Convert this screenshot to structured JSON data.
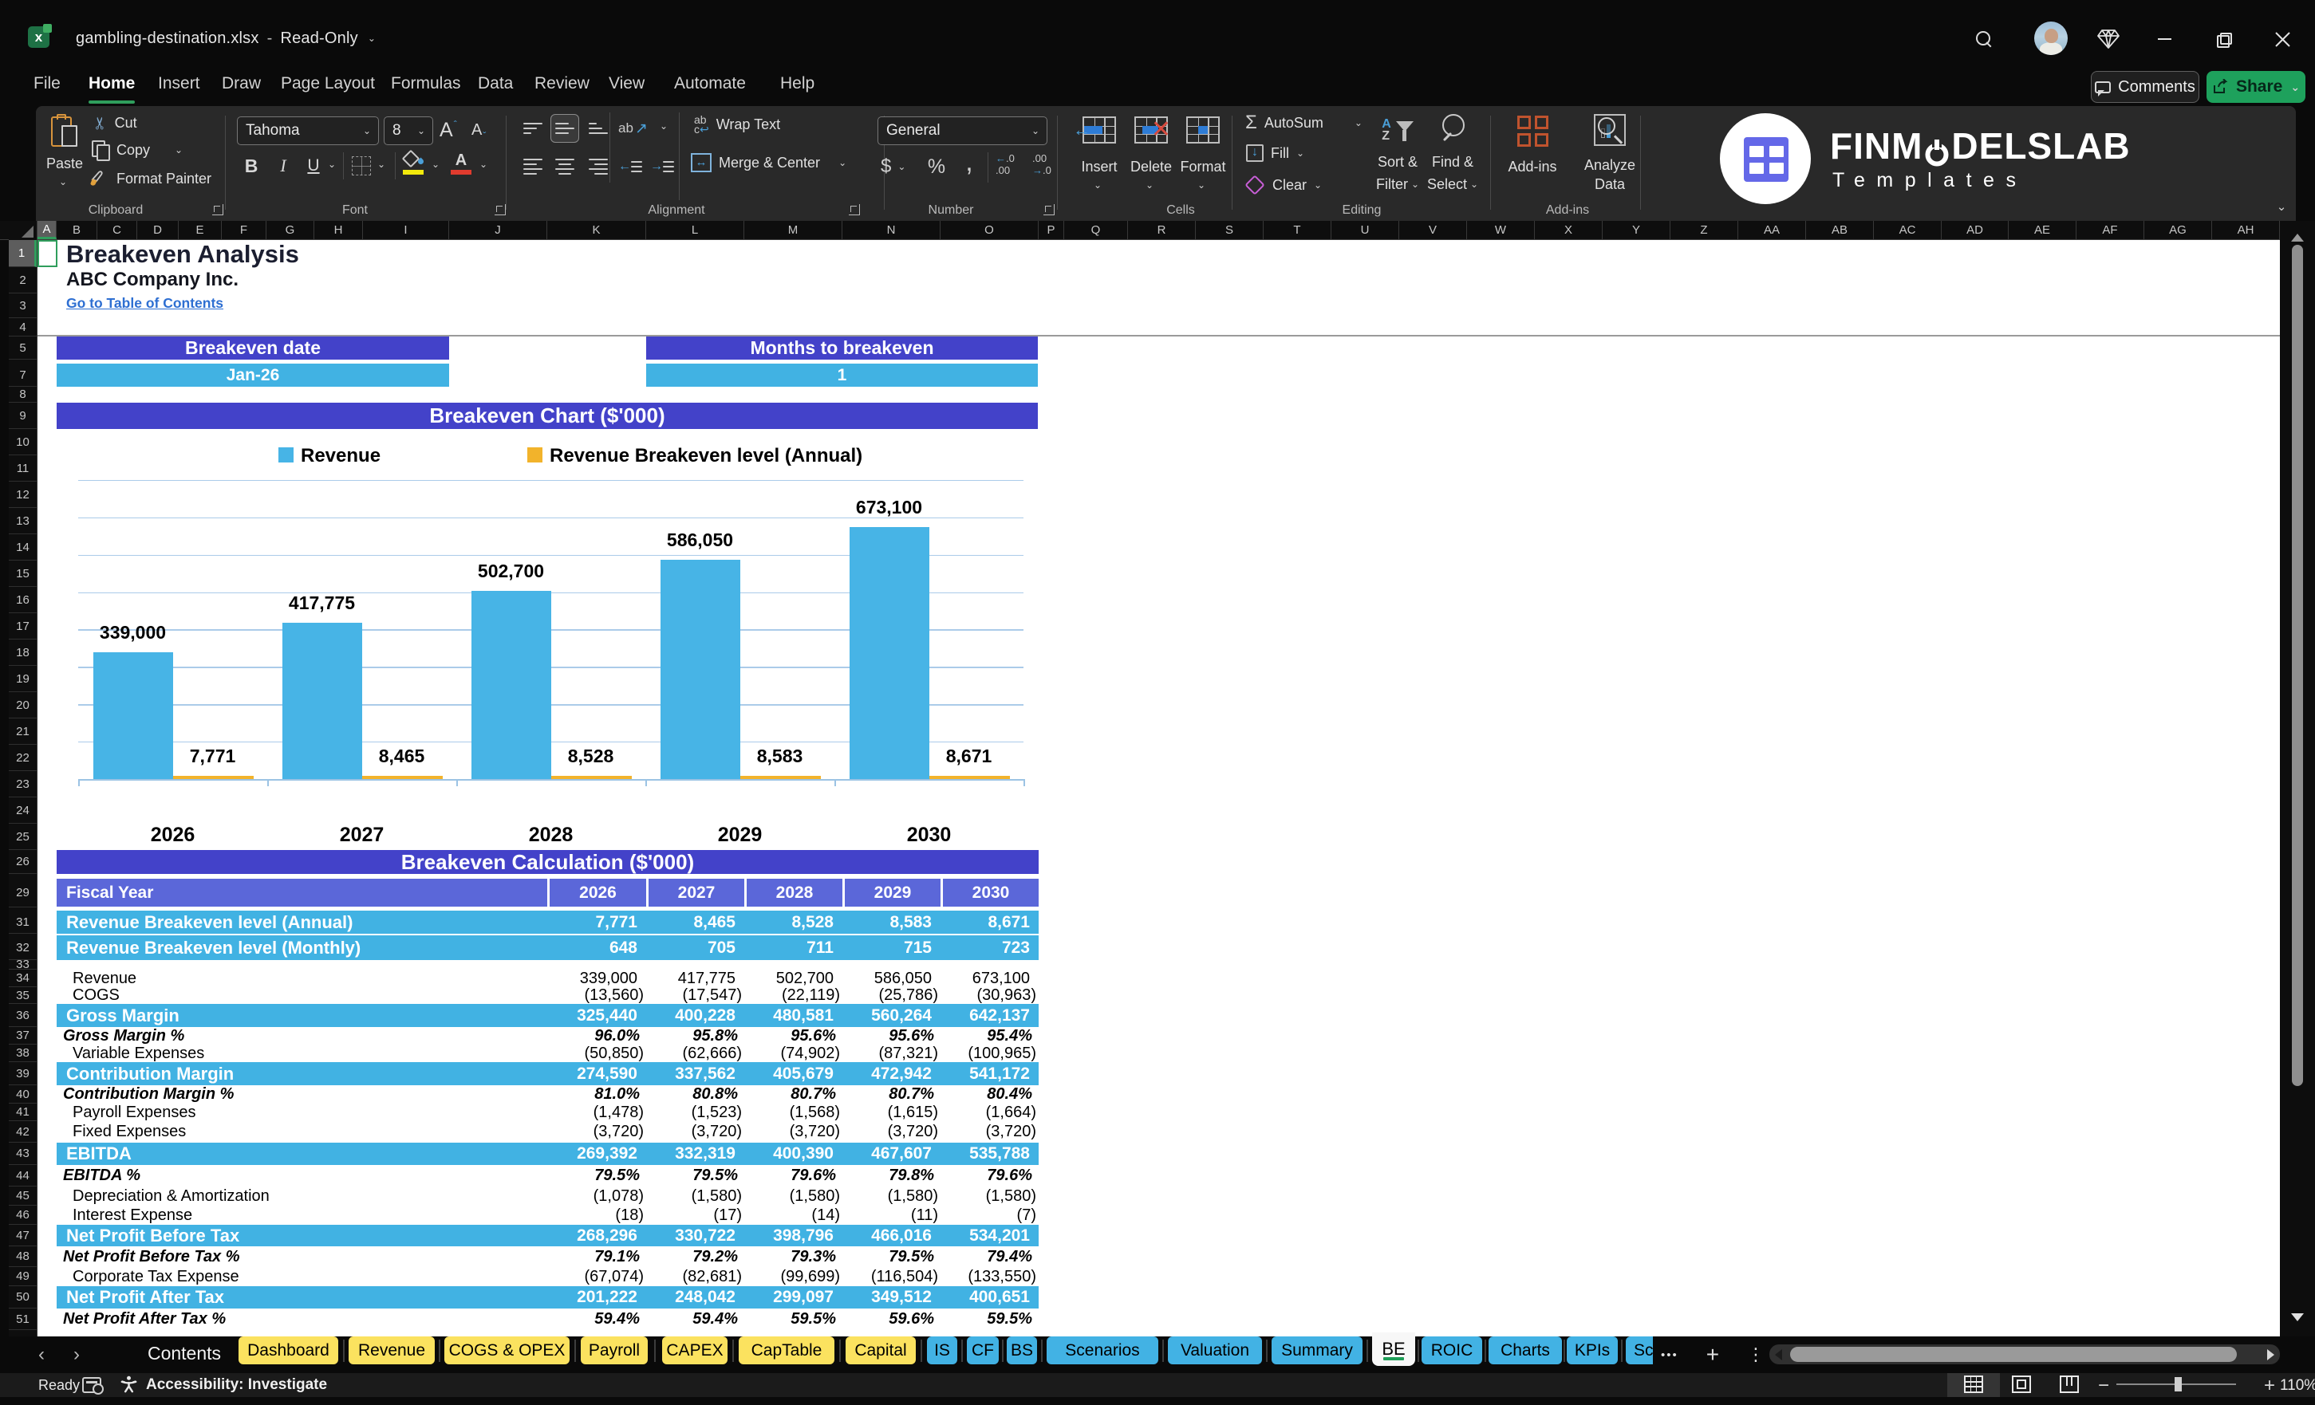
{
  "window": {
    "title": "gambling-destination.xlsx",
    "separator": "-",
    "mode": "Read-Only"
  },
  "menu": {
    "items": [
      "File",
      "Home",
      "Insert",
      "Draw",
      "Page Layout",
      "Formulas",
      "Data",
      "Review",
      "View",
      "Automate",
      "Help"
    ],
    "active_item": "Home",
    "comments": "Comments",
    "share": "Share"
  },
  "ribbon": {
    "clipboard": {
      "label": "Clipboard",
      "paste": "Paste",
      "cut": "Cut",
      "copy": "Copy",
      "format_painter": "Format Painter"
    },
    "font": {
      "label": "Font",
      "family": "Tahoma",
      "size": "8",
      "bold": "B",
      "italic": "I",
      "underline": "U",
      "color_letter": "A"
    },
    "alignment": {
      "label": "Alignment",
      "wrap": "Wrap Text",
      "merge": "Merge & Center",
      "orient": "ab"
    },
    "number": {
      "label": "Number",
      "format": "General",
      "currency": "$",
      "percent": "%",
      "comma": ",",
      "inc_dec": "←.0 .00",
      "dec_dec": ".00 →.0"
    },
    "cells": {
      "label": "Cells",
      "insert": "Insert",
      "delete": "Delete",
      "format": "Format"
    },
    "editing": {
      "label": "Editing",
      "autosum": "AutoSum",
      "fill": "Fill",
      "clear": "Clear",
      "sort1": "Sort &",
      "sort2": "Filter",
      "find1": "Find &",
      "find2": "Select"
    },
    "addins": {
      "label": "Add-ins",
      "button": "Add-ins",
      "analyze1": "Analyze",
      "analyze2": "Data"
    }
  },
  "logo": {
    "brand_pre": "FINM",
    "brand_post": "DELSLAB",
    "sub": "Templates"
  },
  "sheet": {
    "columns": [
      "A",
      "B",
      "C",
      "D",
      "E",
      "F",
      "G",
      "H",
      "I",
      "J",
      "K",
      "L",
      "M",
      "N",
      "O",
      "P",
      "Q",
      "R",
      "S",
      "T",
      "U",
      "V",
      "W",
      "X",
      "Y",
      "Z",
      "AA",
      "AB",
      "AC",
      "AD",
      "AE",
      "AF",
      "AG",
      "AH"
    ],
    "selected_column": "A",
    "rows": [
      "1",
      "2",
      "3",
      "4",
      "5",
      "7",
      "8",
      "9",
      "10",
      "11",
      "12",
      "13",
      "14",
      "15",
      "16",
      "17",
      "18",
      "19",
      "20",
      "21",
      "22",
      "23",
      "24",
      "25",
      "26",
      "29",
      "31",
      "32",
      "33",
      "34",
      "35",
      "36",
      "37",
      "38",
      "39",
      "40",
      "41",
      "42",
      "43",
      "44",
      "45",
      "46",
      "47",
      "48",
      "49",
      "50",
      "51"
    ],
    "selected_row": "1",
    "title": "Breakeven Analysis",
    "company": "ABC Company Inc.",
    "link": "Go to Table of Contents",
    "cards": [
      {
        "label": "Breakeven date",
        "value": "Jan-26"
      },
      {
        "label": "Months to breakeven",
        "value": "1"
      }
    ],
    "chart_header": "Breakeven Chart ($'000)",
    "calc_header": "Breakeven Calculation ($'000)"
  },
  "chart_data": {
    "type": "bar",
    "title": "Breakeven Chart ($'000)",
    "categories": [
      "2026",
      "2027",
      "2028",
      "2029",
      "2030"
    ],
    "series": [
      {
        "name": "Revenue",
        "color": "#47b4e6",
        "values": [
          339000,
          417775,
          502700,
          586050,
          673100
        ],
        "labels": [
          "339,000",
          "417,775",
          "502,700",
          "586,050",
          "673,100"
        ]
      },
      {
        "name": "Revenue Breakeven level (Annual)",
        "color": "#f2b32b",
        "values": [
          7771,
          8465,
          8528,
          8583,
          8671
        ],
        "labels": [
          "7,771",
          "8,465",
          "8,528",
          "8,583",
          "8,671"
        ]
      }
    ],
    "xlabel": "",
    "ylabel": "",
    "ylim": [
      0,
      800000
    ],
    "grid_step": 100000,
    "gridlines": true,
    "legend_position": "top"
  },
  "table": {
    "header": "Fiscal Year",
    "years": [
      "2026",
      "2027",
      "2028",
      "2029",
      "2030"
    ],
    "rows": [
      {
        "label": "Revenue Breakeven level (Annual)",
        "style": "band",
        "values": [
          "7,771",
          "8,465",
          "8,528",
          "8,583",
          "8,671"
        ]
      },
      {
        "label": "Revenue Breakeven level (Monthly)",
        "style": "band",
        "values": [
          "648",
          "705",
          "711",
          "715",
          "723"
        ]
      },
      {
        "label": "",
        "style": "spacer",
        "values": [
          "",
          "",
          "",
          "",
          ""
        ]
      },
      {
        "label": "Revenue",
        "style": "item",
        "values": [
          "339,000",
          "417,775",
          "502,700",
          "586,050",
          "673,100"
        ]
      },
      {
        "label": "COGS",
        "style": "item",
        "values": [
          "(13,560)",
          "(17,547)",
          "(22,119)",
          "(25,786)",
          "(30,963)"
        ]
      },
      {
        "label": "Gross Margin",
        "style": "band",
        "values": [
          "325,440",
          "400,228",
          "480,581",
          "560,264",
          "642,137"
        ]
      },
      {
        "label": "Gross Margin %",
        "style": "pct",
        "values": [
          "96.0%",
          "95.8%",
          "95.6%",
          "95.6%",
          "95.4%"
        ]
      },
      {
        "label": "Variable Expenses",
        "style": "item",
        "values": [
          "(50,850)",
          "(62,666)",
          "(74,902)",
          "(87,321)",
          "(100,965)"
        ]
      },
      {
        "label": "Contribution Margin",
        "style": "band",
        "values": [
          "274,590",
          "337,562",
          "405,679",
          "472,942",
          "541,172"
        ]
      },
      {
        "label": "Contribution Margin %",
        "style": "pct",
        "values": [
          "81.0%",
          "80.8%",
          "80.7%",
          "80.7%",
          "80.4%"
        ]
      },
      {
        "label": "Payroll Expenses",
        "style": "item",
        "values": [
          "(1,478)",
          "(1,523)",
          "(1,568)",
          "(1,615)",
          "(1,664)"
        ]
      },
      {
        "label": "Fixed Expenses",
        "style": "item",
        "values": [
          "(3,720)",
          "(3,720)",
          "(3,720)",
          "(3,720)",
          "(3,720)"
        ]
      },
      {
        "label": "EBITDA",
        "style": "band",
        "values": [
          "269,392",
          "332,319",
          "400,390",
          "467,607",
          "535,788"
        ]
      },
      {
        "label": "EBITDA %",
        "style": "pct",
        "values": [
          "79.5%",
          "79.5%",
          "79.6%",
          "79.8%",
          "79.6%"
        ]
      },
      {
        "label": "Depreciation & Amortization",
        "style": "item",
        "values": [
          "(1,078)",
          "(1,580)",
          "(1,580)",
          "(1,580)",
          "(1,580)"
        ]
      },
      {
        "label": "Interest Expense",
        "style": "item",
        "values": [
          "(18)",
          "(17)",
          "(14)",
          "(11)",
          "(7)"
        ]
      },
      {
        "label": "Net Profit Before Tax",
        "style": "band",
        "values": [
          "268,296",
          "330,722",
          "398,796",
          "466,016",
          "534,201"
        ]
      },
      {
        "label": "Net Profit Before Tax %",
        "style": "pct",
        "values": [
          "79.1%",
          "79.2%",
          "79.3%",
          "79.5%",
          "79.4%"
        ]
      },
      {
        "label": "Corporate Tax Expense",
        "style": "item",
        "values": [
          "(67,074)",
          "(82,681)",
          "(99,699)",
          "(116,504)",
          "(133,550)"
        ]
      },
      {
        "label": "Net Profit After Tax",
        "style": "band",
        "values": [
          "201,222",
          "248,042",
          "299,097",
          "349,512",
          "400,651"
        ]
      },
      {
        "label": "Net Profit After Tax %",
        "style": "pct",
        "values": [
          "59.4%",
          "59.4%",
          "59.5%",
          "59.6%",
          "59.5%"
        ]
      }
    ]
  },
  "tabs": {
    "back": "‹",
    "forward": "›",
    "items": [
      {
        "label": "Contents",
        "style": "plain"
      },
      {
        "label": "Dashboard",
        "style": "yellow"
      },
      {
        "label": "Revenue",
        "style": "yellow"
      },
      {
        "label": "COGS & OPEX",
        "style": "yellow"
      },
      {
        "label": "Payroll",
        "style": "yellow"
      },
      {
        "label": "CAPEX",
        "style": "yellow"
      },
      {
        "label": "CapTable",
        "style": "yellow"
      },
      {
        "label": "Capital",
        "style": "yellow"
      },
      {
        "label": "IS",
        "style": "blue"
      },
      {
        "label": "CF",
        "style": "blue"
      },
      {
        "label": "BS",
        "style": "blue"
      },
      {
        "label": "Scenarios",
        "style": "blue"
      },
      {
        "label": "Valuation",
        "style": "blue"
      },
      {
        "label": "Summary",
        "style": "blue"
      },
      {
        "label": "BE",
        "style": "active"
      },
      {
        "label": "ROIC",
        "style": "blue"
      },
      {
        "label": "Charts",
        "style": "blue"
      },
      {
        "label": "KPIs",
        "style": "blue"
      },
      {
        "label": "Sc",
        "style": "blue-cut"
      }
    ],
    "more": "•••",
    "add": "+",
    "menu": "⋮"
  },
  "status": {
    "ready": "Ready",
    "accessibility": "Accessibility: Investigate",
    "zoom_minus": "−",
    "zoom_plus": "+",
    "zoom": "110%"
  }
}
